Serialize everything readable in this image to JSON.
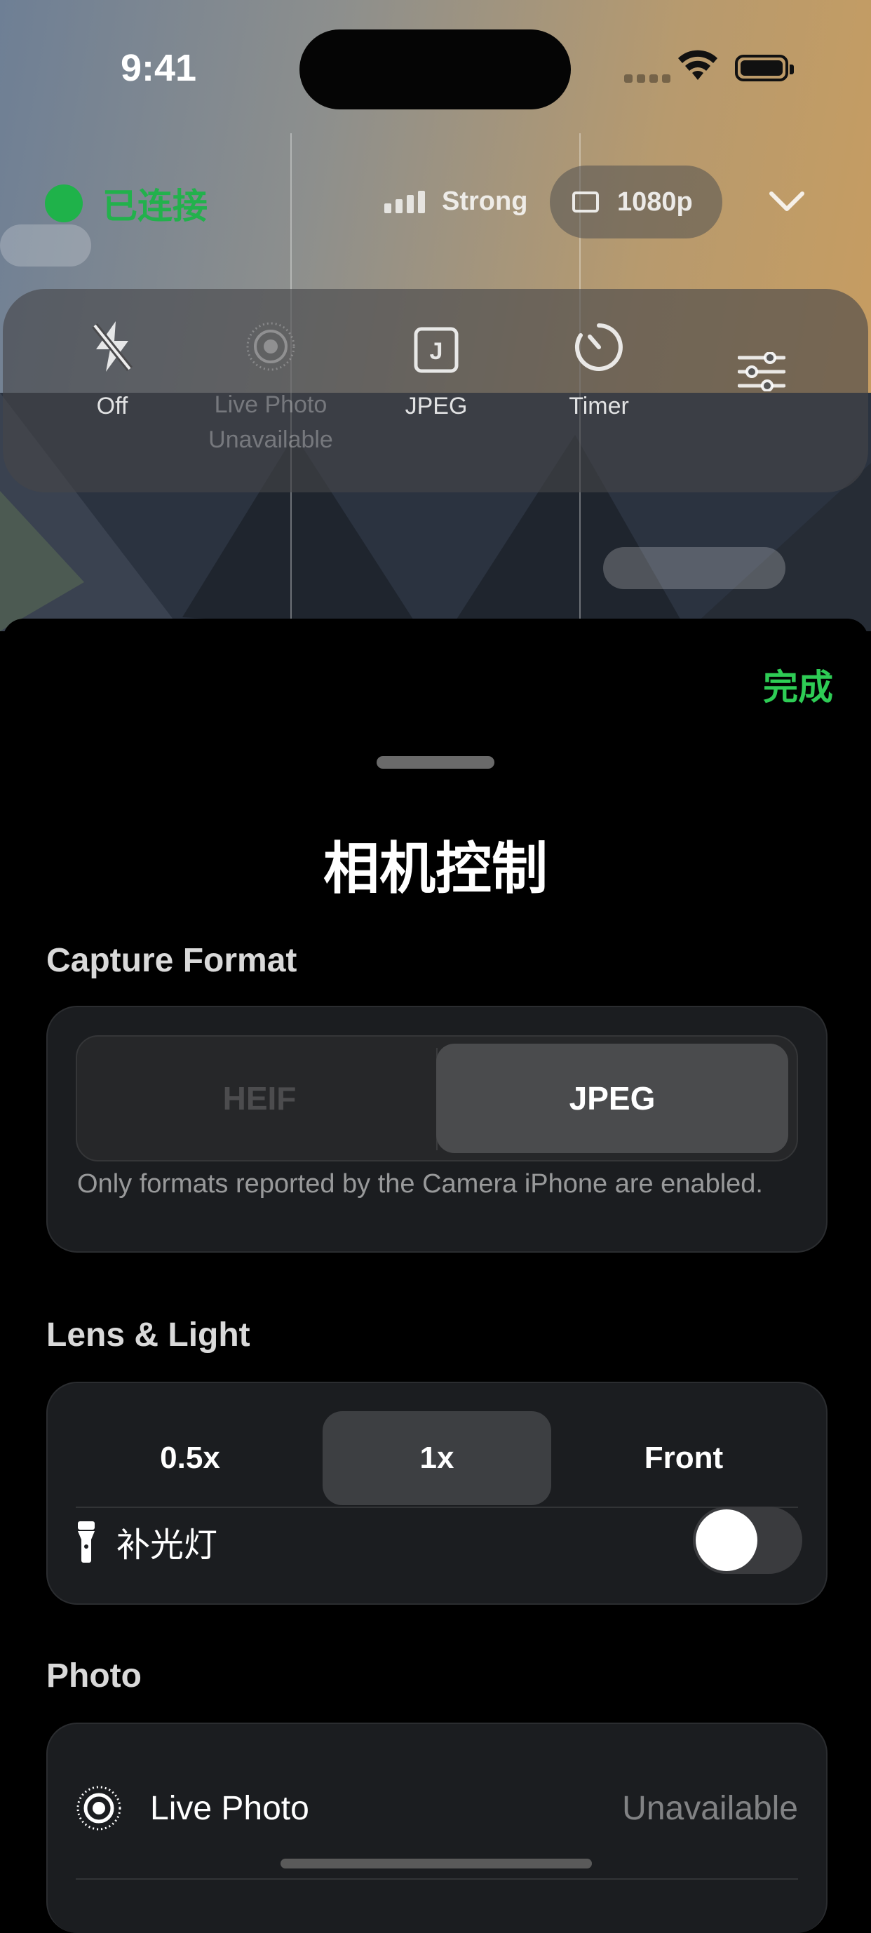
{
  "status_bar": {
    "time": "9:41"
  },
  "connection": {
    "status": "已连接",
    "signal": "Strong",
    "resolution": "1080p"
  },
  "toolbar": {
    "items": [
      {
        "label": "Off",
        "icon": "flash-off-icon",
        "enabled": true
      },
      {
        "label": "Live Photo\nUnavailable",
        "icon": "live-photo-icon",
        "enabled": false
      },
      {
        "label": "JPEG",
        "icon": "jpeg-format-icon",
        "enabled": true
      },
      {
        "label": "Timer",
        "icon": "timer-icon",
        "enabled": true
      },
      {
        "label": "",
        "icon": "sliders-icon",
        "enabled": true
      }
    ]
  },
  "sheet": {
    "done": "完成",
    "title": "相机控制",
    "capture_format": {
      "title": "Capture Format",
      "options": [
        "HEIF",
        "JPEG"
      ],
      "selected": "JPEG",
      "note": "Only formats reported by the Camera iPhone are enabled."
    },
    "lens_light": {
      "title": "Lens & Light",
      "lenses": [
        "0.5x",
        "1x",
        "Front"
      ],
      "selected": "1x",
      "torch_label": "补光灯",
      "torch_on": false
    },
    "photo": {
      "title": "Photo",
      "live_photo_label": "Live Photo",
      "live_photo_value": "Unavailable"
    }
  },
  "colors": {
    "accent_green": "#2ecc55",
    "connected_dot": "#1fb24a"
  }
}
